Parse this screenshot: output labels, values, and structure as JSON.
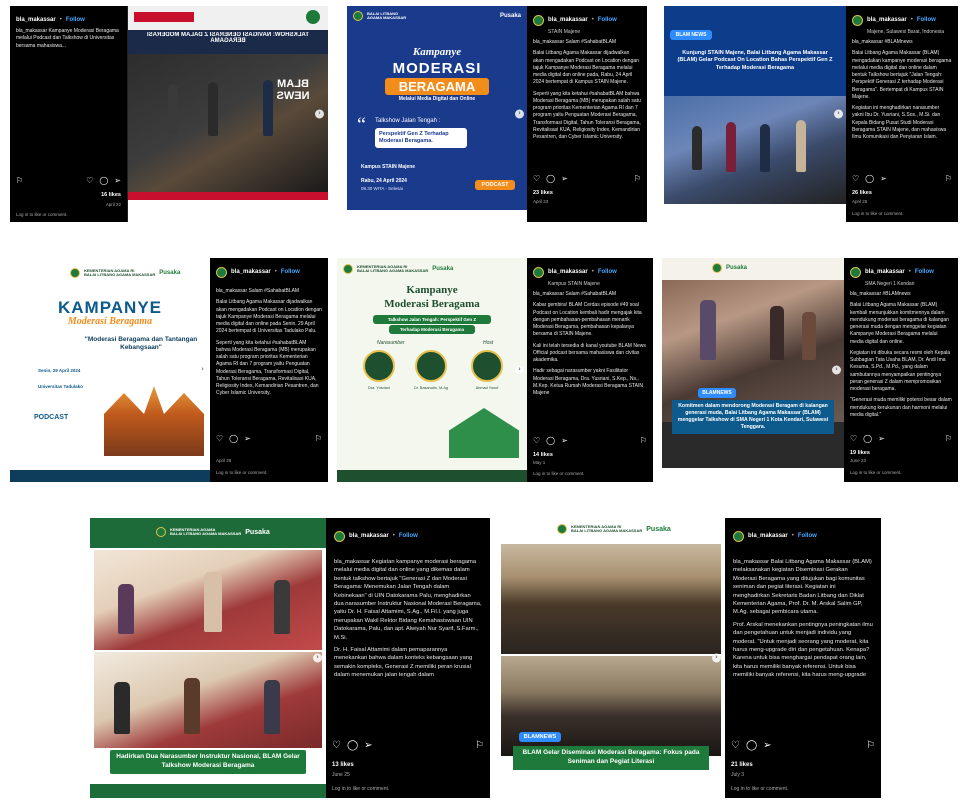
{
  "common": {
    "username": "bla_makassar",
    "follow": "Follow",
    "login_text": "Log in to like or comment."
  },
  "post1": {
    "location": "",
    "caption": "bla_makassar Kampanye Moderasi Beragama melalui Podcast dan Talkshow di Universitas bersama mahasiswa...",
    "likes": "16 likes",
    "date": "April 22",
    "media_title": "BLAM NEWS",
    "media_sub": "TALKSHOW: NAVIGASI GENERASI Z DALAM MODERASI BERAGAMA"
  },
  "post2": {
    "location": "STAIN Majene",
    "caption_p1": "bla_makassar Salam #SahabatBLAM",
    "caption_p2": "Balai Litbang Agama Makassar dijadwalkan akan mengadakan Podcast on Location dengan tajuk Kampanye Moderasi Beragama melalui media digital dan online pada, Rabu, 24 April 2024 bertempat di Kampus STAIN Majene.",
    "caption_p3": "Seperti yang kita ketahui #sahabatBLAM bahwa Moderasi Beragama (MB) merupakan salah satu program prioritas Kementerian Agama RI dan 7 program yaitu Penguatan Moderasi Beragama, Transformasi Digital, Tahun Toleransi Beragama, Revitalisasi KUA, Religiosity Index, Kemandirian Pesantren, dan Cyber Islamic University.",
    "likes": "23 likes",
    "date": "April 23",
    "m_kampanye": "Kampanye",
    "m_moderasi": "MODERASI",
    "m_beragama": "BERAGAMA",
    "m_sub": "Melalui Media Digital dan Online",
    "m_talk": "Talkshow Jalan Tengah :",
    "m_topic": "Perspektif Gen Z Terhadap Moderasi Beragama.",
    "m_venue": "Kampus STAIN Majene",
    "m_date": "Rabu, 24 April 2024",
    "m_time": "08.30 WITA - Selesai",
    "m_podcast": "PODCAST"
  },
  "post3": {
    "location": "Majene, Sulawesi Barat, Indonesia",
    "caption_p1": "bla_makassar #BLAMnews",
    "caption_p2": "Balai Litbang Agama Makassar (BLAM) mengadakan kampanye moderasi beragama melalui media digital dan online dalam bentuk Talkshow bertajuk \"Jalan Tengah: Perspektif Generasi Z terhadap Moderasi Beragama\". Bertempat di Kampus STAIN Majene.",
    "caption_p3": "Kegiatan ini menghadirkan narasumber yakni Ibu Dr. Yusriani, S.Sos., M.Si. dan Kepala Bidang Pusat Studi Moderasi Beragama STAIN Majene, dan mahasiswa Ilmu Komunikasi dan Penyiaran Islam.",
    "likes": "26 likes",
    "date": "April 25",
    "m_tag": "BLAM NEWS",
    "m_title": "Kunjungi STAIN Majene, Balai Litbang Agama Makassar (BLAM) Gelar Podcast On Location Bahas Perspektif Gen Z Terhadap Moderasi Beragama"
  },
  "post4": {
    "location": "",
    "caption_p1": "bla_makassar Salam #SahabatBLAM",
    "caption_p2": "Balai Litbang Agama Makassar dijadwalkan akan mengadakan Podcast on Location dengan tajuk Kampanye Moderasi Beragama melalui media digital dan online pada Senin, 29 April 2024 bertempat di Universitas Tadulako Palu.",
    "caption_p3": "Seperti yang kita ketahui #sahabatBLAM bahwa Moderasi Beragama (MB) merupakan salah satu program prioritas Kementerian Agama RI dan 7 program yaitu Penguatan Moderasi Beragama, Transformasi Digital, Tahun Toleransi Beragama, Revitalisasi KUA, Religiosity Index, Kemandirian Pesantren, dan Cyber Islamic University.",
    "likes": "",
    "date": "April 28",
    "m_kampanye": "KAMPANYE",
    "m_moderasi": "Moderasi Beragama",
    "m_topic": "\"Moderasi Beragama dan Tantangan Kebangsaan\"",
    "m_date": "Senin, 29 April 2024",
    "m_venue": "Universitas Tadulako",
    "m_podcast": "PODCAST"
  },
  "post5": {
    "location": "Kampus STAIN Majene",
    "caption_p1": "bla_makassar Salam #SahabatBLAM",
    "caption_p2": "Kabar gembira! BLAM Cerdas episode #49 soal Podcast on Location kembali hadir mengajak kita dengan pembahasan-pembahasan menarik Moderasi Beragama, pembahasan kepalanya bersama di STAIN Majene.",
    "caption_p3": "Kali ini telah tersedia di kanal youtube BLAM News Official podcast bersama mahasiswa dan civitas akademika.",
    "caption_p4": "Hadir sebagai narasumber yakni Fasilitator Moderasi Beragama, Dra. Yusriani, S.Kep., Ns., M.Kep. Ketua Rumah Moderasi Beragama STAIN Majene",
    "likes": "14 likes",
    "date": "May 1",
    "m_kampanye": "Kampanye",
    "m_moderasi": "Moderasi Beragama",
    "m_pill1": "Talkshow Jalan Tengah: Perspektif Gen Z",
    "m_pill2": "Terhadap Moderasi Beragama",
    "m_nara": "Narasumber",
    "m_host": "Host",
    "m_s1": "Dra. Yusriani",
    "m_s2": "Dr. Basarudin, M.Ag",
    "m_s3": "Ahmad Yusuf"
  },
  "post6": {
    "location": "SMA Negeri 1 Kendari",
    "caption_p1": "bla_makassar #BLAMnews",
    "caption_p2": "Balai Litbang Agama Makassar (BLAM) kembali menunjukkan komitmennya dalam mendukung moderasi beragama di kalangan generasi muda dengan menggelar kegiatan Kampanye Moderasi Beragama melalui media digital dan online.",
    "caption_p3": "Kegiatan ini dibuka secara resmi oleh Kepala Subbagian Tata Usaha BLAM, Dr. Andi Ima Kesuma, S.Pd., M.Pd., yang dalam sambutannya menyampaikan pentingnya peran generasi Z dalam mempromosikan moderasi beragama.",
    "caption_p4": "\"Generasi muda memiliki potensi besar dalam mendukung kerukunan dan harmoni melalui media digital.\"",
    "likes": "19 likes",
    "date": "June 23",
    "m_tag": "BLAMNEWS",
    "m_title": "Komitmen dalam mendorong Moderasi Beragam di kalangan generasi muda, Balai Litbang Agama Makassar (BLAM) menggelar Talkshow di SMA Negeri 1 Kota Kendari, Sulawesi Tenggara."
  },
  "post7": {
    "caption_p1": "bla_makassar Kegiatan kampanye moderasi beragama melalui media digital dan online yang dikemas dalam bentuk talkshow bertajuk \"Generasi Z dan Moderasi Beragama: Menemukan Jalan Tengah dalam Kebinekaan\" di UIN Datokarama Palu, menghadirkan dua narasumber Instruktur Nasional Moderasi Beragama, yaitu Dr. H. Faisal Attamimi, S.Ag., M.Fil.I. yang juga merupakan Wakil Rektor Bidang Kemahasiswaan UIN Datokarama, Palu, dan apt. Alwiyah Nur Syarif, S.Farm., M.Si.",
    "caption_p2": "Dr. H. Faisal Attamimi dalam pemaparannya menekankan bahwa dalam konteks kebangsaan yang semakin kompleks, Generasi Z memiliki peran krusial dalam menemukan jalan tengah dalam",
    "likes": "13 likes",
    "date": "June 25",
    "m_title": "Hadirkan Dua Narasumber Instruktur Nasional, BLAM Gelar Talkshow Moderasi Beragama",
    "m_pusaka": "Pusaka"
  },
  "post8": {
    "caption_p1": "bla_makassar Balai Litbang Agama Makassar (BLAM) melaksanakan kegiatan Diseminasi Gerakan Moderasi Beragama yang ditujukan bagi komunitas seniman dan pegiat literasi. Kegiatan ini menghadirkan Sekretaris Badan Litbang dan Diklat Kementerian Agama, Prof. Dr. M. Arskal Salim GP, M.Ag. sebagai pembicara utama.",
    "caption_p2": "Prof. Arskal menekankan pentingnya peningkatan ilmu dan pengetahuan untuk menjadi individu yang moderat. \"Untuk menjadi seorang yang moderat, kita harus meng-upgrade diri dan pengetahuan. Kenapa? Karena untuk bisa menghargai pendapat orang lain, kita harus memiliki banyak referensi. Untuk bisa memiliki banyak referensi, kita harus meng-upgrade",
    "likes": "21 likes",
    "date": "July 3",
    "m_tag": "BLAMNEWS",
    "m_title": "BLAM Gelar Diseminasi Moderasi Beragama: Fokus pada Seniman dan Pegiat Literasi",
    "m_pusaka": "Pusaka"
  }
}
